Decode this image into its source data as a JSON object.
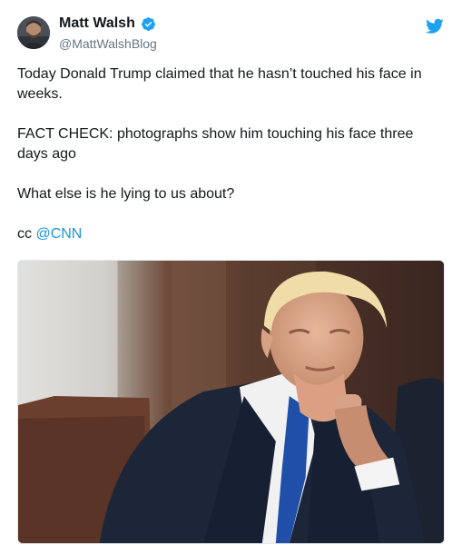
{
  "tweet": {
    "author": {
      "display_name": "Matt Walsh",
      "handle": "@MattWalshBlog",
      "verified": true,
      "avatar_icon": "avatar-photo"
    },
    "brand_icon": "twitter-bird-icon",
    "paragraphs": [
      "Today Donald Trump claimed that he hasn’t touched his face in weeks.",
      "FACT CHECK: photographs show him touching his face three days ago",
      "What else is he lying to us about?"
    ],
    "cc_prefix": "cc ",
    "cc_mention": "@CNN",
    "media": {
      "kind": "photo",
      "subject": "man-with-hand-on-chin-photo"
    },
    "colors": {
      "link": "#1b95e0",
      "verified": "#1da1f2",
      "secondary_text": "#657786",
      "primary_text": "#14171a"
    }
  }
}
